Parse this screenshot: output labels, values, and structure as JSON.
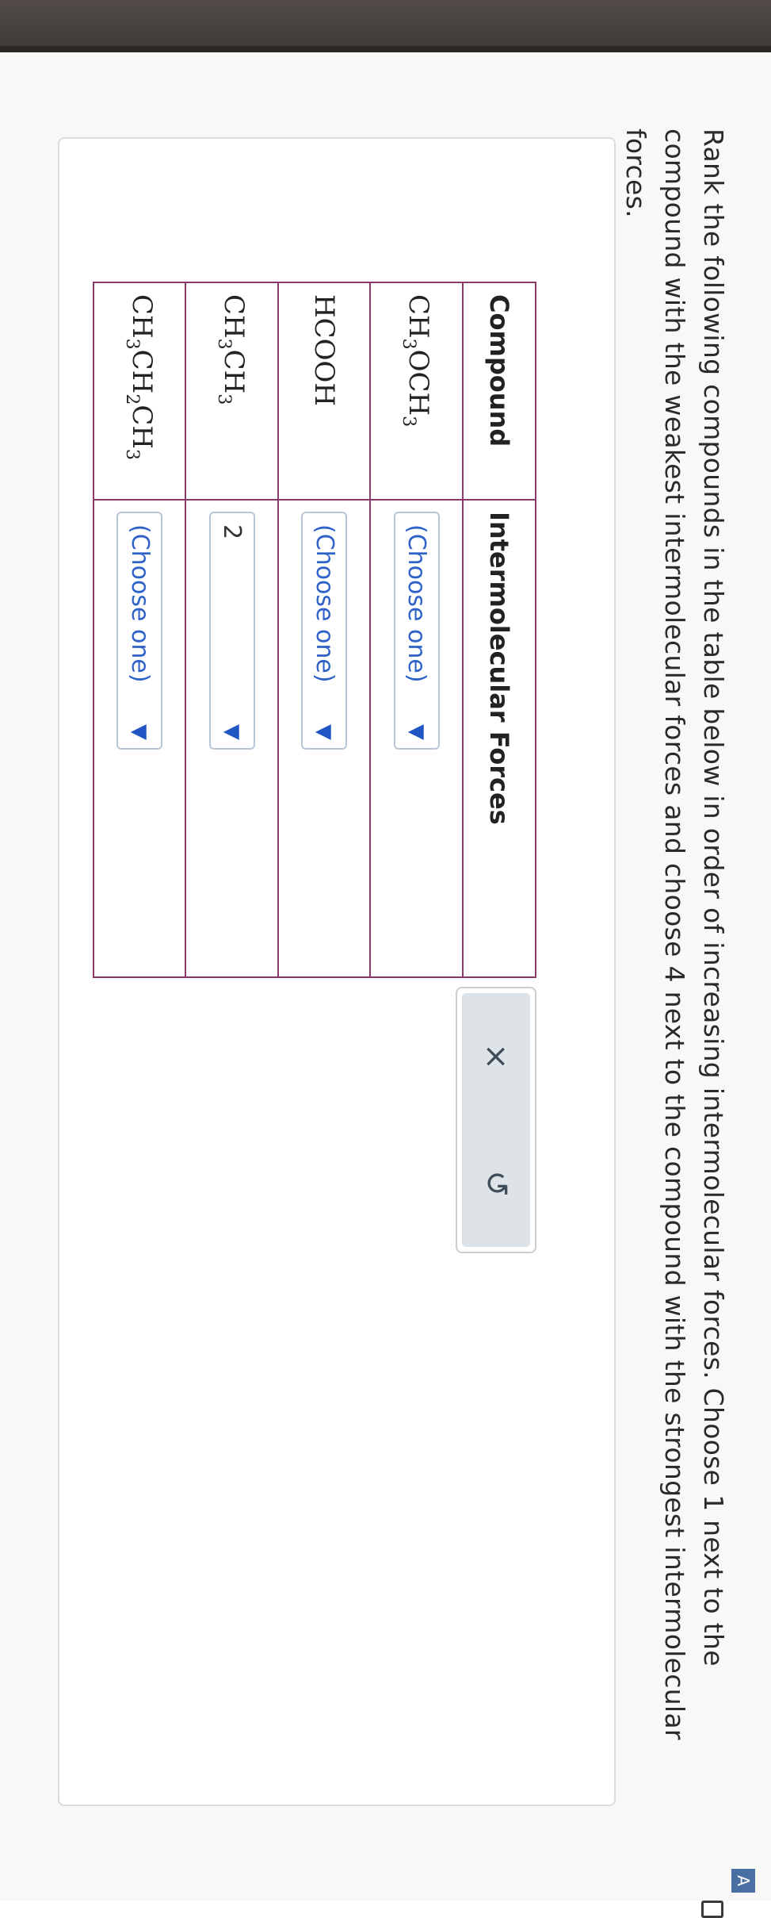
{
  "question": {
    "text": "Rank the following compounds in the table below in order of increasing intermolecular forces. Choose 1 next to the compound with the weakest intermolecular forces and choose 4 next to the compound with the strongest intermolecular forces."
  },
  "table": {
    "headers": [
      "Compound",
      "Intermolecular Forces"
    ],
    "rows": [
      {
        "formula": [
          [
            "CH",
            ""
          ],
          [
            "3",
            "sub"
          ],
          [
            "OCH",
            ""
          ],
          [
            "3",
            "sub"
          ]
        ],
        "selection": "(Choose one)",
        "is_placeholder": true
      },
      {
        "formula": [
          [
            "HCOOH",
            ""
          ]
        ],
        "selection": "(Choose one)",
        "is_placeholder": true
      },
      {
        "formula": [
          [
            "CH",
            ""
          ],
          [
            "3",
            "sub"
          ],
          [
            "CH",
            ""
          ],
          [
            "3",
            "sub"
          ]
        ],
        "selection": "2",
        "is_placeholder": false
      },
      {
        "formula": [
          [
            "CH",
            ""
          ],
          [
            "3",
            "sub"
          ],
          [
            "CH",
            ""
          ],
          [
            "2",
            "sub"
          ],
          [
            "CH",
            ""
          ],
          [
            "3",
            "sub"
          ]
        ],
        "selection": "(Choose one)",
        "is_placeholder": true
      }
    ]
  },
  "actions": {
    "clear_label": "×",
    "reset_label": "↺"
  },
  "icons": {
    "caret": "▼",
    "side_tab": "A"
  }
}
